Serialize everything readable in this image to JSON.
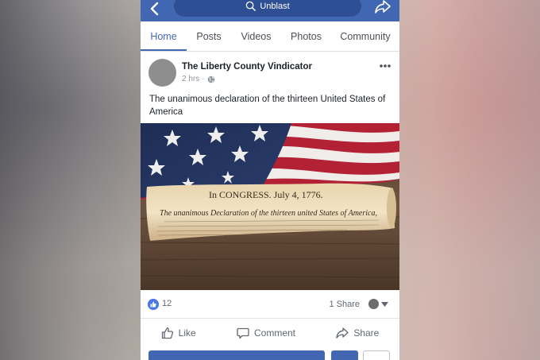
{
  "topbar": {
    "search_text": "Unblast",
    "color": "#4267b2"
  },
  "tabs": [
    {
      "label": "Home",
      "active": true
    },
    {
      "label": "Posts",
      "active": false
    },
    {
      "label": "Videos",
      "active": false
    },
    {
      "label": "Photos",
      "active": false
    },
    {
      "label": "Community",
      "active": false
    }
  ],
  "post": {
    "page_name": "The Liberty County Vindicator",
    "time": "2 hrs",
    "separator": "·",
    "text": "The unanimous declaration of the thirteen United States of America",
    "image_caption_header": "In CONGRESS. July 4, 1776.",
    "image_caption_title": "The unanimous Declaration of the thirteen united States of America,"
  },
  "reactions": {
    "like_count": "12",
    "share_count": "1 Share"
  },
  "actions": {
    "like": "Like",
    "comment": "Comment",
    "share": "Share"
  },
  "icons": {
    "back": "back-arrow-icon",
    "search": "search-icon",
    "share_top": "share-arrow-icon",
    "globe": "globe-icon",
    "more": "more-dots-icon",
    "like": "thumbs-up-icon",
    "comment": "comment-icon",
    "share": "share-icon"
  }
}
